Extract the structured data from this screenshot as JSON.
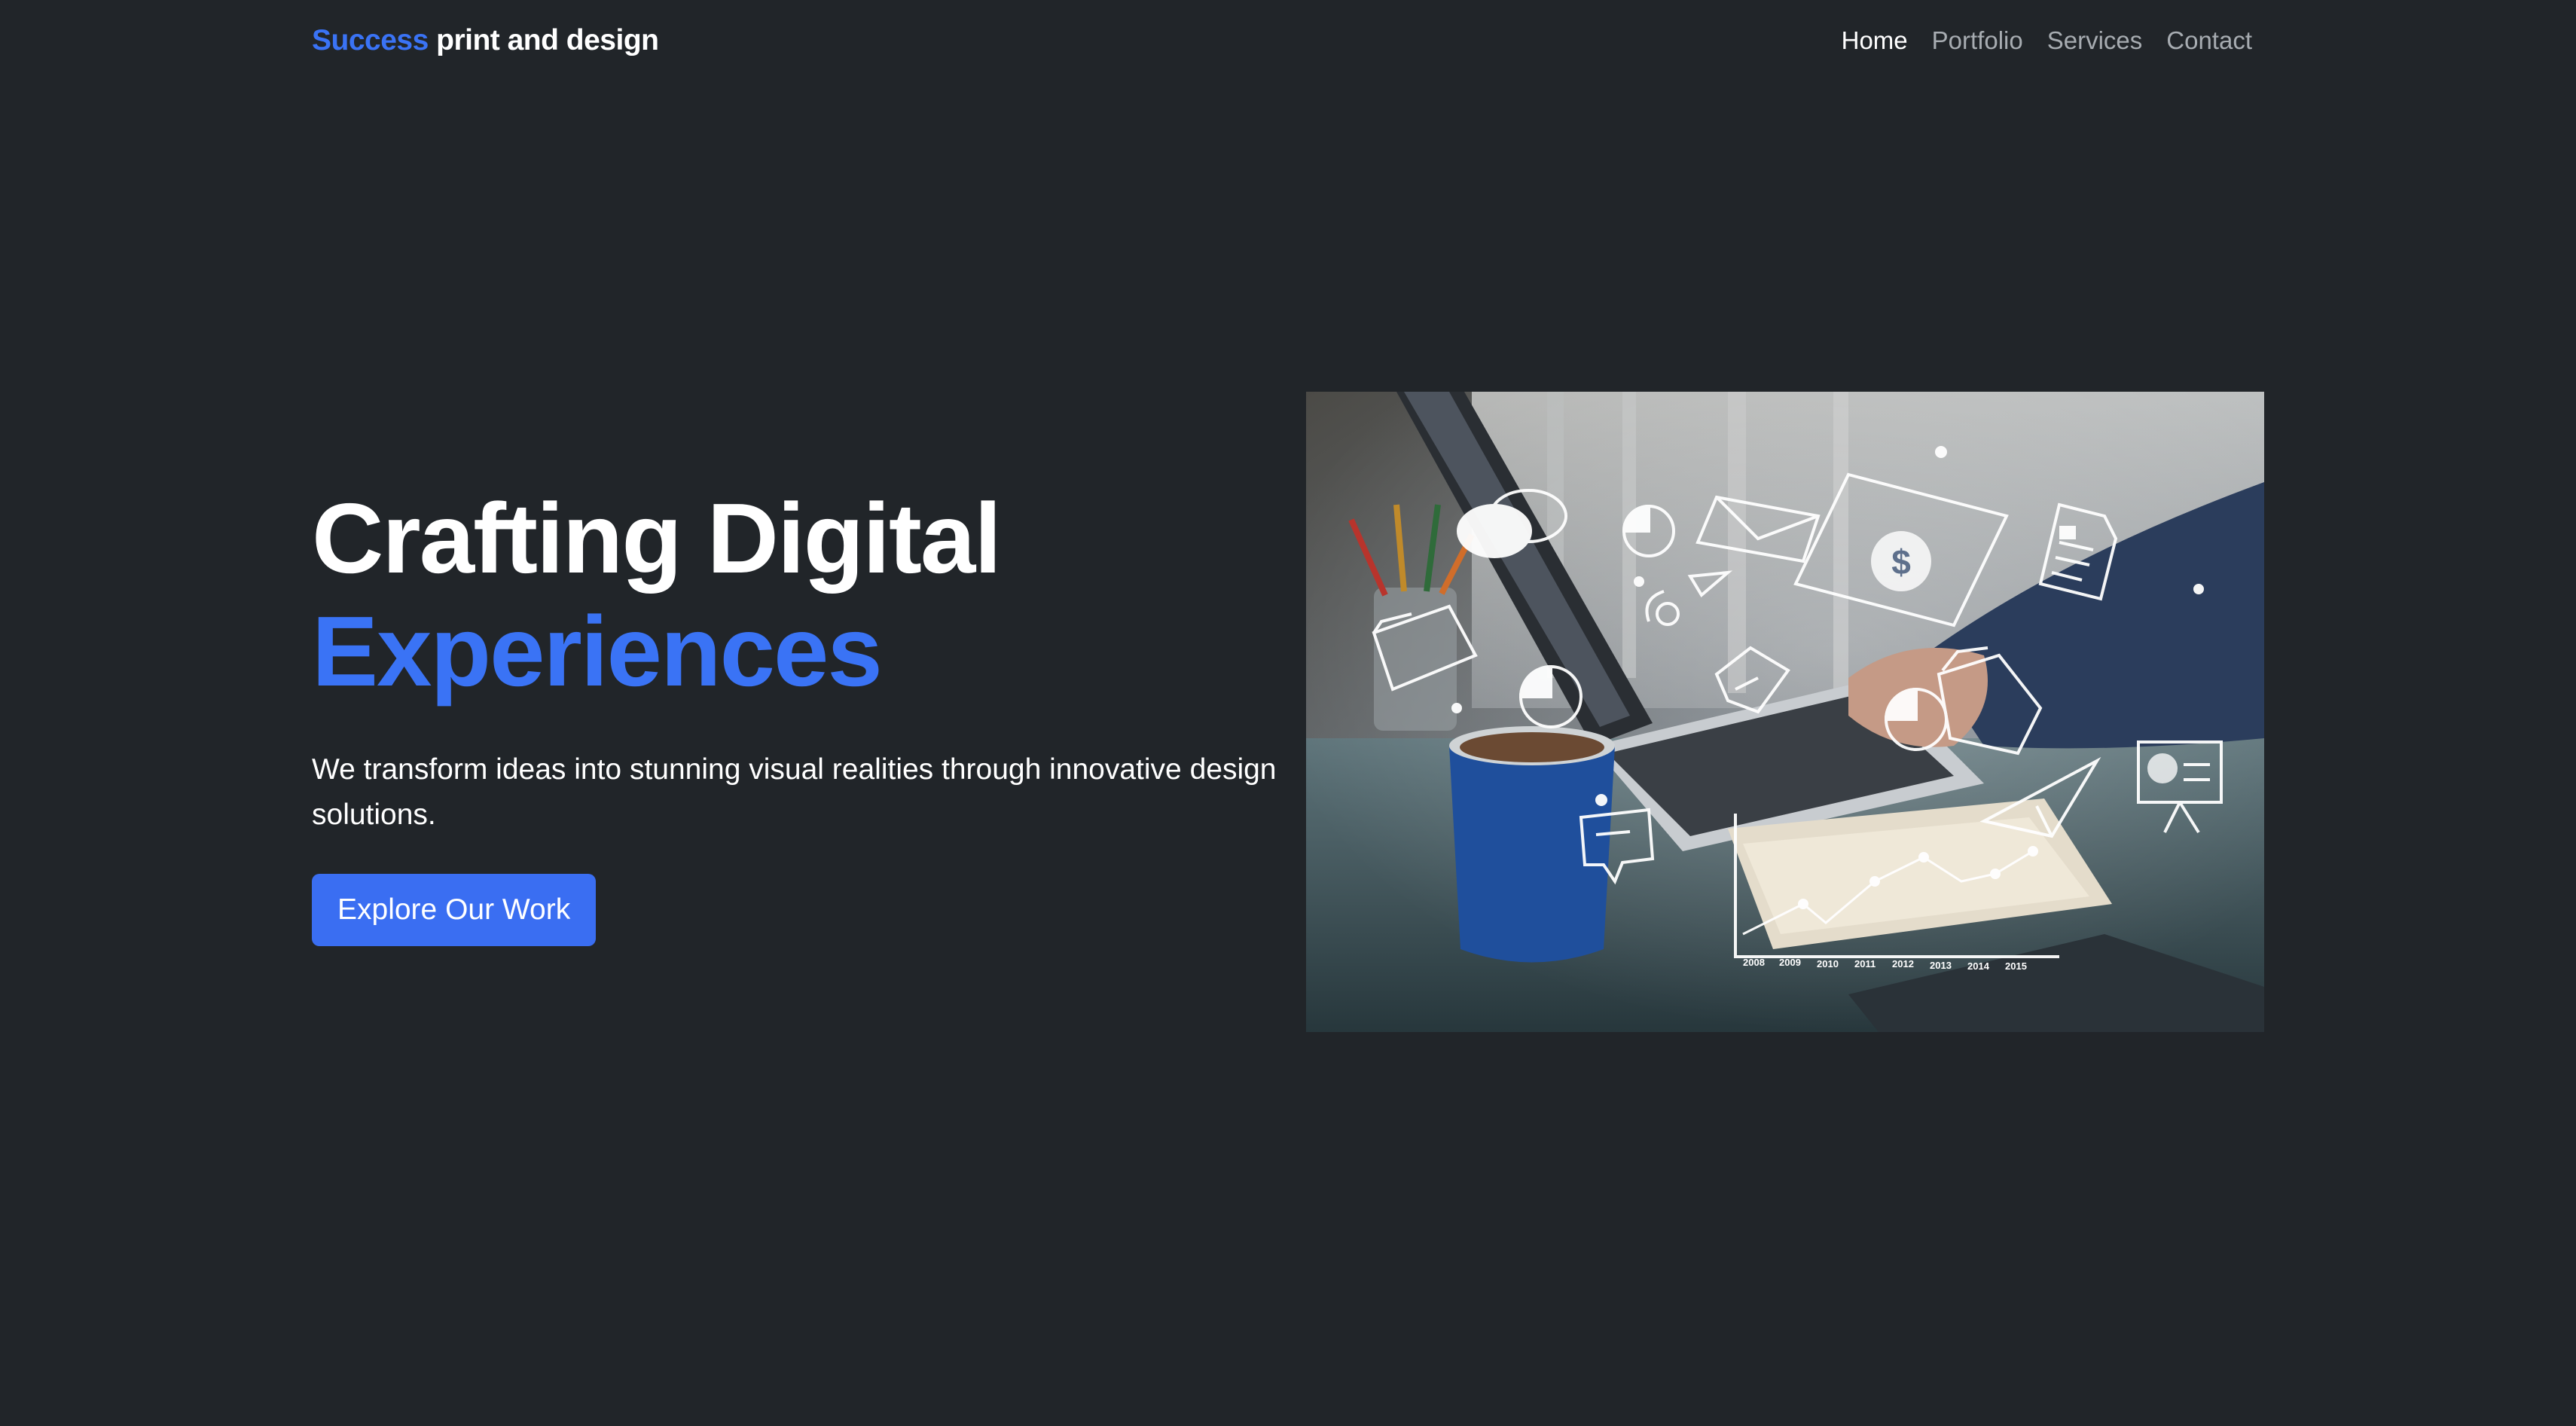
{
  "navbar": {
    "brand_accent": "Success",
    "brand_rest": "print and design",
    "links": [
      {
        "label": "Home",
        "active": true
      },
      {
        "label": "Portfolio",
        "active": false
      },
      {
        "label": "Services",
        "active": false
      },
      {
        "label": "Contact",
        "active": false
      }
    ]
  },
  "hero": {
    "title_line1": "Crafting Digital",
    "title_line2": "Experiences",
    "subtitle": "We transform ideas into stunning visual realities through innovative design solutions.",
    "cta_label": "Explore Our Work",
    "image_chart_years": [
      "2008",
      "2009",
      "2010",
      "2011",
      "2012",
      "2013",
      "2014",
      "2015"
    ]
  },
  "colors": {
    "background": "#212529",
    "accent": "#3a73f5",
    "button": "#3a6ef2",
    "nav_inactive": "#a7acb1",
    "text": "#ffffff"
  },
  "icons": [
    "chat-icon",
    "pie-chart-icon",
    "mail-icon",
    "dollar-card-icon",
    "document-icon",
    "folder-icon",
    "paper-plane-icon",
    "handshake-icon",
    "presentation-icon",
    "message-icon",
    "line-chart-icon"
  ]
}
